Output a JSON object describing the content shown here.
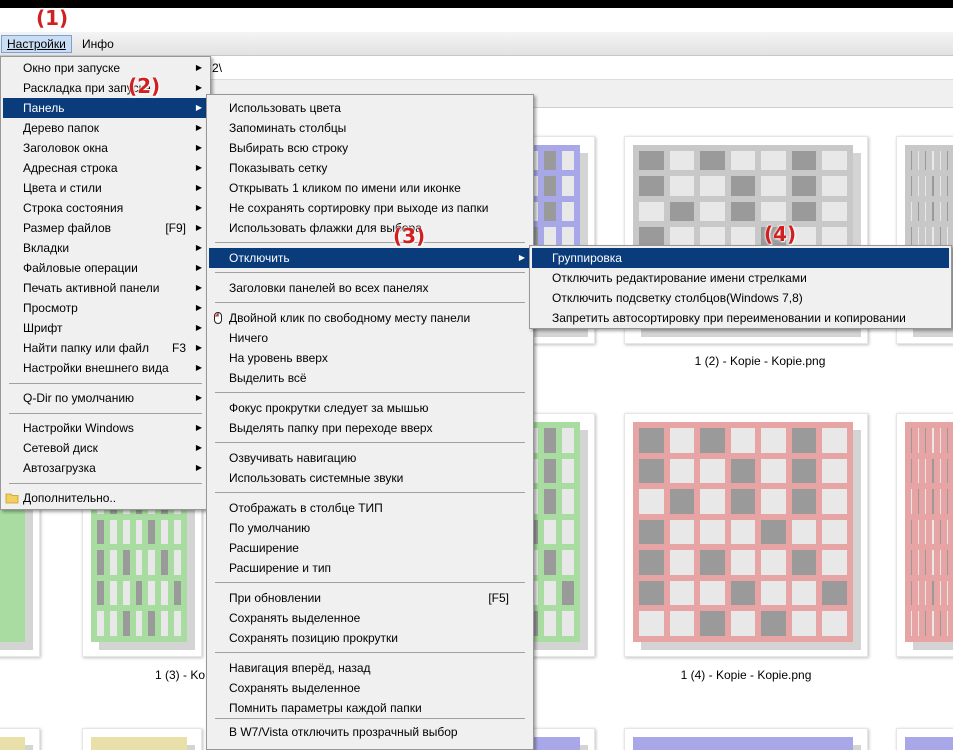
{
  "menubar": {
    "settings": "Настройки",
    "info": "Инфо"
  },
  "address": {
    "path": "2\\"
  },
  "annotations": [
    "(1)",
    "(2)",
    "(3)",
    "(4)"
  ],
  "captions": {
    "row1_right": "1 (2) - Kopie - Kopie.png",
    "row2_left": "1 (3) - Ko",
    "row2_right": "1 (4) - Kopie - Kopie.png"
  },
  "menu1": [
    {
      "label": "Окно при запуске",
      "sub": true
    },
    {
      "label": "Раскладка при запуске",
      "sub": true
    },
    {
      "label": "Панель",
      "sub": true
    },
    {
      "label": "Дерево папок",
      "sub": true
    },
    {
      "label": "Заголовок окна",
      "sub": true
    },
    {
      "label": "Адресная строка",
      "sub": true
    },
    {
      "label": "Цвета и стили",
      "sub": true
    },
    {
      "label": "Строка состояния",
      "sub": true
    },
    {
      "label": "Размер файлов",
      "shortcut": "[F9]",
      "sub": true
    },
    {
      "label": "Вкладки",
      "sub": true
    },
    {
      "label": "Файловые операции",
      "sub": true
    },
    {
      "label": "Печать активной панели",
      "sub": true
    },
    {
      "label": "Просмотр",
      "sub": true
    },
    {
      "label": "Шрифт",
      "sub": true
    },
    {
      "label": "Найти папку или файл",
      "shortcut": "F3",
      "sub": true
    },
    {
      "label": "Настройки внешнего вида",
      "sub": true
    },
    {
      "label": "Q-Dir по умолчанию",
      "sub": true
    },
    {
      "label": "Настройки Windows",
      "sub": true
    },
    {
      "label": "Сетевой диск",
      "sub": true
    },
    {
      "label": "Автозагрузка",
      "sub": true
    },
    {
      "label": "Дополнительно.."
    }
  ],
  "menu2": [
    {
      "label": "Использовать цвета"
    },
    {
      "label": "Запоминать столбцы"
    },
    {
      "label": "Выбирать всю строку"
    },
    {
      "label": "Показывать сетку"
    },
    {
      "label": "Открывать 1 кликом по имени или иконке"
    },
    {
      "label": "Не сохранять сортировку при выходе из папки"
    },
    {
      "label": "Использовать флажки для выбора"
    },
    {
      "label": "Отключить"
    },
    {
      "label": "Заголовки панелей во всех панелях"
    },
    {
      "label": "Двойной клик по свободному месту панели"
    },
    {
      "label": "Ничего"
    },
    {
      "label": "На уровень вверх"
    },
    {
      "label": "Выделить всё"
    },
    {
      "label": "Фокус прокрутки следует за мышью"
    },
    {
      "label": "Выделять папку при переходе вверх"
    },
    {
      "label": "Озвучивать навигацию"
    },
    {
      "label": "Использовать системные звуки"
    },
    {
      "label": "Отображать в столбце ТИП"
    },
    {
      "label": "По умолчанию"
    },
    {
      "label": "Расширение"
    },
    {
      "label": "Расширение и тип"
    },
    {
      "label": "При обновлении",
      "shortcut": "[F5]"
    },
    {
      "label": "Сохранять выделенное"
    },
    {
      "label": "Сохранять позицию прокрутки"
    },
    {
      "label": "Навигация вперёд, назад"
    },
    {
      "label": "Сохранять выделенное"
    },
    {
      "label": "Помнить параметры каждой папки"
    },
    {
      "label": "В W7/Vista отключить прозрачный выбор"
    }
  ],
  "menu3": [
    {
      "label": "Группировка"
    },
    {
      "label": "Отключить редактирование имени стрелками"
    },
    {
      "label": "Отключить подсветку столбцов(Windows 7,8)"
    },
    {
      "label": "Запретить автосортировку при переименовании и копировании"
    }
  ],
  "colors": {
    "selection": "#0a3b7a",
    "annotation": "#d21f1f",
    "blue": "#a8a8e8",
    "gray": "#c8c8c8",
    "green": "#a8dca0",
    "red": "#e6a4a4",
    "yellow": "#e8e0a8"
  }
}
